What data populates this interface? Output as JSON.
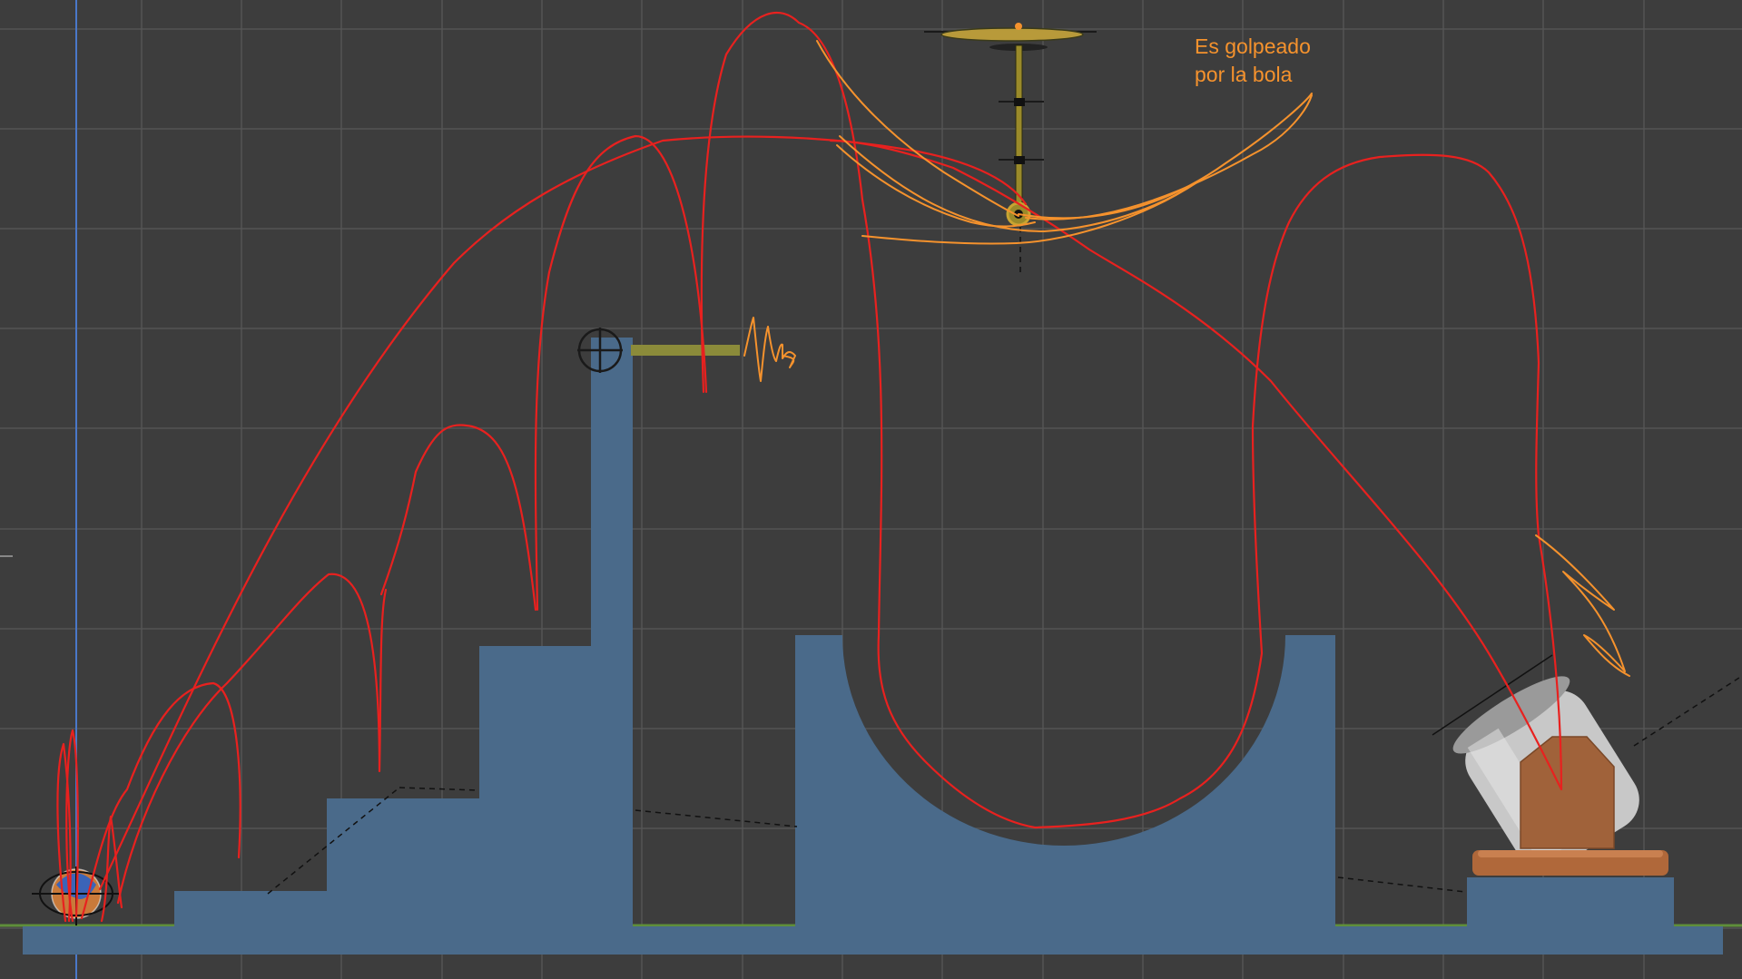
{
  "viewport": {
    "background": "#3d3d3d",
    "grid_color": "#555555",
    "y_axis_color": "#4a78c9",
    "ground_line_color": "#5f8f3a",
    "geometry_color": "#4a6a8a"
  },
  "annotation": {
    "line1": "Es golpeado",
    "line2": "por la bola",
    "color": "#f5922d"
  },
  "strokes": {
    "trajectory_color": "#e8211f",
    "highlight_color": "#f5922d"
  },
  "objects": {
    "ball": "ball",
    "cannon": "cannon",
    "pendulum": "pendulum",
    "lever": "lever",
    "stairs": "stairs",
    "half_pipe": "half-pipe"
  }
}
